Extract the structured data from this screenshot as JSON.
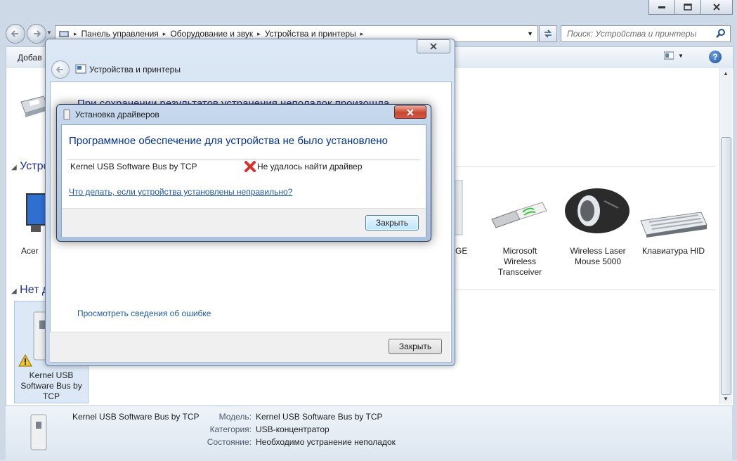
{
  "explorer": {
    "breadcrumb": [
      "Панель управления",
      "Оборудование и звук",
      "Устройства и принтеры"
    ],
    "search_placeholder": "Поиск: Устройства и принтеры",
    "toolbar": {
      "add_device": "Добав"
    },
    "sections": [
      {
        "label": "Устро"
      },
      {
        "label": "Нет д"
      }
    ],
    "devices": [
      {
        "label": "Acer"
      },
      {
        "label": "GE"
      },
      {
        "label": "Microsoft Wireless Transceiver"
      },
      {
        "label": "Wireless Laser Mouse 5000"
      },
      {
        "label": "Клавиатура HID"
      },
      {
        "label": "Kernel USB Software Bus by TCP"
      }
    ],
    "details": {
      "name": "Kernel USB Software Bus by TCP",
      "rows": [
        {
          "key": "Модель:",
          "value": "Kernel USB Software Bus by TCP"
        },
        {
          "key": "Категория:",
          "value": "USB-концентратор"
        },
        {
          "key": "Состояние:",
          "value": "Необходимо устранение неполадок"
        }
      ]
    }
  },
  "troubleshooter": {
    "title": "Устройства и принтеры",
    "partial_text": "При сохранении результатов устранения неполадок произошла",
    "view_error_link": "Просмотреть сведения об ошибке",
    "close_button": "Закрыть"
  },
  "driver_dialog": {
    "title": "Установка драйверов",
    "heading": "Программное обеспечение для устройства не было установлено",
    "device_name": "Kernel USB Software Bus by TCP",
    "status": "Не удалось найти драйвер",
    "help_link": "Что делать, если устройства установлены неправильно?",
    "close_button": "Закрыть"
  },
  "colors": {
    "error_red": "#d9302c",
    "link_blue": "#1f58a7",
    "heading_blue": "#003399"
  }
}
